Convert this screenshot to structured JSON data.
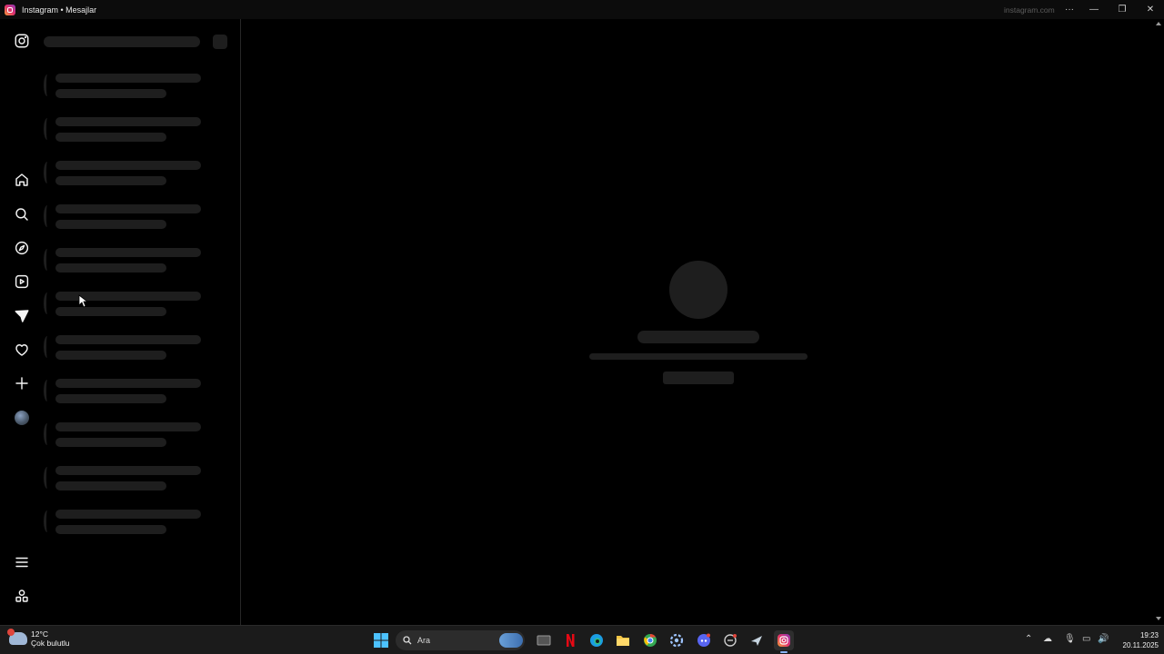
{
  "window": {
    "title": "Instagram • Mesajlar",
    "domain": "instagram.com",
    "more_label": "···",
    "minimize_label": "—",
    "maximize_label": "❐",
    "close_label": "✕"
  },
  "nav": {
    "items": [
      {
        "name": "instagram-logo-icon"
      },
      {
        "name": "home-icon"
      },
      {
        "name": "search-icon"
      },
      {
        "name": "explore-compass-icon"
      },
      {
        "name": "reels-icon"
      },
      {
        "name": "messages-icon"
      },
      {
        "name": "notifications-heart-icon"
      },
      {
        "name": "create-plus-icon"
      },
      {
        "name": "profile-avatar"
      },
      {
        "name": "menu-icon"
      },
      {
        "name": "also-from-meta-icon"
      }
    ]
  },
  "conversation_list": {
    "state": "loading",
    "placeholder_rows": 11
  },
  "main": {
    "state": "loading"
  },
  "taskbar": {
    "weather": {
      "temp": "12°C",
      "desc": "Çok bulutlu"
    },
    "search_label": "Ara",
    "time": "19:23",
    "date": "20.11.2025",
    "apps": [
      {
        "name": "windows-start-icon"
      },
      {
        "name": "task-view-icon"
      },
      {
        "name": "netflix-icon"
      },
      {
        "name": "edge-browser-icon"
      },
      {
        "name": "file-explorer-icon"
      },
      {
        "name": "chrome-icon"
      },
      {
        "name": "settings-app-icon"
      },
      {
        "name": "discord-icon"
      },
      {
        "name": "app-icon"
      },
      {
        "name": "steam-icon"
      },
      {
        "name": "instagram-app-icon"
      }
    ],
    "colors": {
      "accent": "#8ab4f8",
      "instagram": "#e1306c"
    }
  }
}
